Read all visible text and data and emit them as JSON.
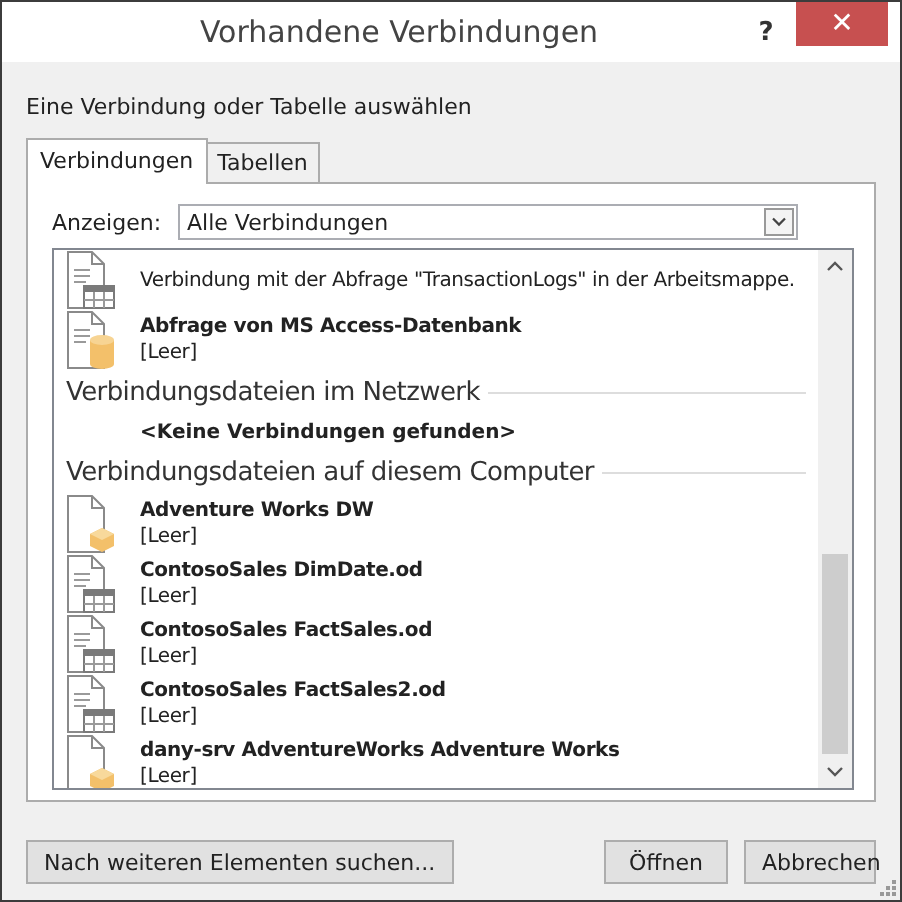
{
  "window": {
    "title": "Vorhandene Verbindungen",
    "help": "?",
    "close": "✕"
  },
  "instruction": "Eine Verbindung oder Tabelle auswählen",
  "tabs": [
    {
      "label": "Verbindungen",
      "selected": true
    },
    {
      "label": "Tabellen",
      "selected": false
    }
  ],
  "filter": {
    "label": "Anzeigen:",
    "value": "Alle Verbindungen"
  },
  "list": [
    {
      "kind": "table",
      "description": "Verbindung mit der Abfrage \"TransactionLogs\" in der Arbeitsmappe."
    },
    {
      "kind": "database",
      "name": "Abfrage von MS Access-Datenbank",
      "description": "[Leer]"
    },
    {
      "kind": "heading",
      "text": "Verbindungsdateien im Netzwerk"
    },
    {
      "kind": "note",
      "text": "<Keine Verbindungen gefunden>"
    },
    {
      "kind": "heading",
      "text": "Verbindungsdateien auf diesem Computer"
    },
    {
      "kind": "cube",
      "name": "Adventure Works DW",
      "description": "[Leer]"
    },
    {
      "kind": "table",
      "name": "ContosoSales DimDate.od",
      "description": "[Leer]"
    },
    {
      "kind": "table",
      "name": "ContosoSales FactSales.od",
      "description": "[Leer]"
    },
    {
      "kind": "table",
      "name": "ContosoSales FactSales2.od",
      "description": "[Leer]"
    },
    {
      "kind": "cube",
      "name": "dany-srv AdventureWorks Adventure Works",
      "description": "[Leer]"
    }
  ],
  "buttons": {
    "browse": "Nach weiteren Elementen suchen...",
    "open": "Öffnen",
    "cancel": "Abbrechen"
  }
}
